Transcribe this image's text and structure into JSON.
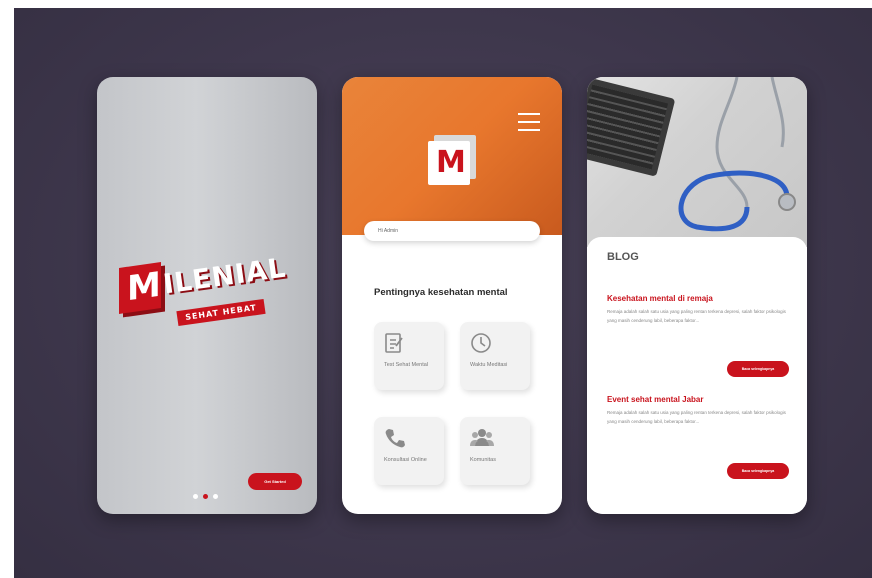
{
  "splash": {
    "logo_m": "M",
    "logo_rest": "ILENIAL",
    "logo_sub": "SEHAT HEBAT",
    "button_label": "Get Started",
    "dots_total": 3,
    "dots_active_index": 1
  },
  "home": {
    "app_icon_letter": "M",
    "search_placeholder": "Hi Admin",
    "section_title": "Pentingnya kesehatan mental",
    "menu": [
      {
        "label": "Test Sehat Mental",
        "icon": "clipboard-icon"
      },
      {
        "label": "Waktu Meditasi",
        "icon": "clock-icon"
      },
      {
        "label": "Konsultasi Online",
        "icon": "phone-icon"
      },
      {
        "label": "Komunitas",
        "icon": "community-icon"
      }
    ]
  },
  "blog": {
    "heading": "BLOG",
    "posts": [
      {
        "title": "Kesehatan mental di remaja",
        "body": "Remaja adalah salah satu usia yang paling rentan terkena depresi, salah faktor psikologis yang masih cenderung labil, beberapa faktor...",
        "button": "Baca selengkapnya"
      },
      {
        "title": "Event sehat mental Jabar",
        "body": "Remaja adalah salah satu usia yang paling rentan terkena depresi, salah faktor psikologis yang masih cenderung labil, beberapa faktor...",
        "button": "Baca selengkapnya"
      }
    ]
  },
  "colors": {
    "background": "#3e374c",
    "brand_red": "#c9131d",
    "header_orange": "#e8772d"
  }
}
